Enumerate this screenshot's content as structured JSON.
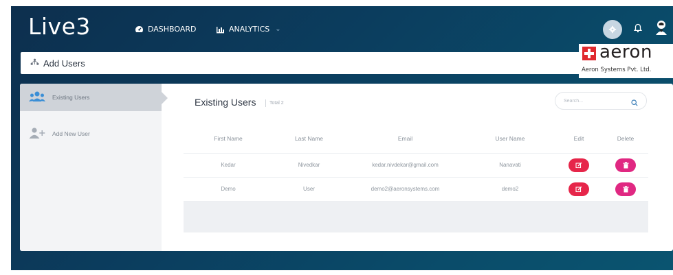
{
  "app": {
    "logo": "Live3",
    "accent": "#e6264a",
    "background": "#0b3d5e"
  },
  "nav": {
    "items": [
      {
        "label": "DASHBOARD",
        "icon": "dashboard-icon"
      },
      {
        "label": "ANALYTICS",
        "icon": "analytics-icon",
        "dropdown": true
      }
    ],
    "right_icons": [
      "settings-icon",
      "bell-icon",
      "user-avatar-icon"
    ]
  },
  "page": {
    "title": "Add Users",
    "icon": "users-sitemap-icon"
  },
  "brand": {
    "name": "aeron",
    "subtitle": "Aeron Systems Pvt. Ltd.",
    "color": "#e02a2f"
  },
  "sidebar": {
    "items": [
      {
        "label": "Existing Users",
        "icon": "users-group-icon",
        "active": true
      },
      {
        "label": "Add New User",
        "icon": "user-add-icon",
        "active": false
      }
    ]
  },
  "main": {
    "title": "Existing Users",
    "total_label": "Total 2",
    "search": {
      "placeholder": "Search..."
    }
  },
  "table": {
    "columns": [
      "First Name",
      "Last Name",
      "Email",
      "User Name",
      "Edit",
      "Delete"
    ],
    "rows": [
      {
        "first_name": "Kedar",
        "last_name": "Nivedkar",
        "email": "kedar.nivdekar@gmail.com",
        "user_name": "Nanavati"
      },
      {
        "first_name": "Demo",
        "last_name": "User",
        "email": "demo2@aeronsystems.com",
        "user_name": "demo2"
      }
    ],
    "edit_color": "#e6264a",
    "delete_color": "#e02882"
  }
}
